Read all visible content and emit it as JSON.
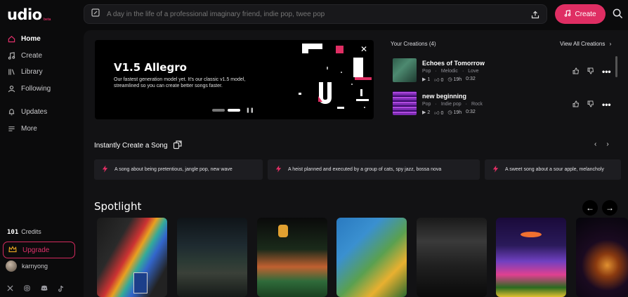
{
  "app": {
    "logo": "udio",
    "logo_badge": "beta"
  },
  "sidebar": {
    "items": [
      {
        "label": "Home",
        "icon": "home-icon",
        "active": true
      },
      {
        "label": "Create",
        "icon": "music-note-icon"
      },
      {
        "label": "Library",
        "icon": "library-icon"
      },
      {
        "label": "Following",
        "icon": "user-icon"
      },
      {
        "label": "Updates",
        "icon": "bell-icon"
      },
      {
        "label": "More",
        "icon": "menu-icon"
      }
    ],
    "credits_value": "101",
    "credits_label": "Credits",
    "upgrade_label": "Upgrade",
    "username": "karnyong"
  },
  "topbar": {
    "prompt_placeholder": "A day in the life of a professional imaginary friend, indie pop, twee pop",
    "create_label": "Create"
  },
  "banner": {
    "title": "V1.5 Allegro",
    "description": "Our fastest generation model yet. It's our classic v1.5 model, streamlined so you can create better songs faster."
  },
  "creations": {
    "heading": "Your Creations (4)",
    "view_all": "View All Creations",
    "items": [
      {
        "title": "Echoes of Tomorrow",
        "tags": [
          "Pop",
          "·",
          "Melodic",
          "·",
          "Love"
        ],
        "plays": "1",
        "likes": "0",
        "age": "19h",
        "duration": "0:32"
      },
      {
        "title": "new beginning",
        "tags": [
          "Pop",
          "·",
          "Indie pop",
          "·",
          "Rock"
        ],
        "plays": "2",
        "likes": "0",
        "age": "19h",
        "duration": "0:32"
      }
    ]
  },
  "instant": {
    "heading": "Instantly Create a Song",
    "suggestions": [
      "A song about being pretentious, jangle pop, new wave",
      "A heist planned and executed by a group of cats, spy jazz, bossa nova",
      "A sweet song about a sour apple, melancholy"
    ]
  },
  "spotlight": {
    "heading": "Spotlight"
  },
  "colors": {
    "accent": "#df2e63",
    "background": "#0b0b0c",
    "panel": "#121214"
  }
}
